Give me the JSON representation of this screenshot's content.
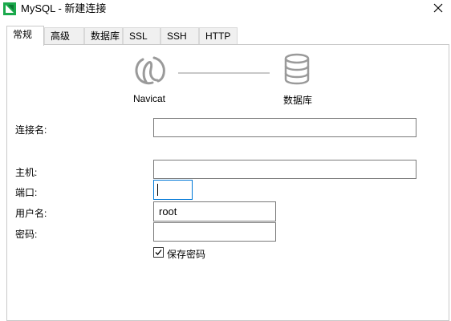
{
  "window": {
    "title": "MySQL - 新建连接"
  },
  "tabs": [
    {
      "label": "常规",
      "active": true
    },
    {
      "label": "高级"
    },
    {
      "label": "数据库"
    },
    {
      "label": "SSL"
    },
    {
      "label": "SSH"
    },
    {
      "label": "HTTP"
    }
  ],
  "diagram": {
    "client_label": "Navicat",
    "server_label": "数据库"
  },
  "form": {
    "connection_name": {
      "label": "连接名:",
      "value": ""
    },
    "host": {
      "label": "主机:",
      "value": ""
    },
    "port": {
      "label": "端口:",
      "value": ""
    },
    "username": {
      "label": "用户名:",
      "value": "root"
    },
    "password": {
      "label": "密码:",
      "value": ""
    },
    "save_password": {
      "label": "保存密码",
      "checked": true
    }
  },
  "colors": {
    "accent_focus": "#0078d7",
    "navicat_green": "#1ba94c"
  }
}
